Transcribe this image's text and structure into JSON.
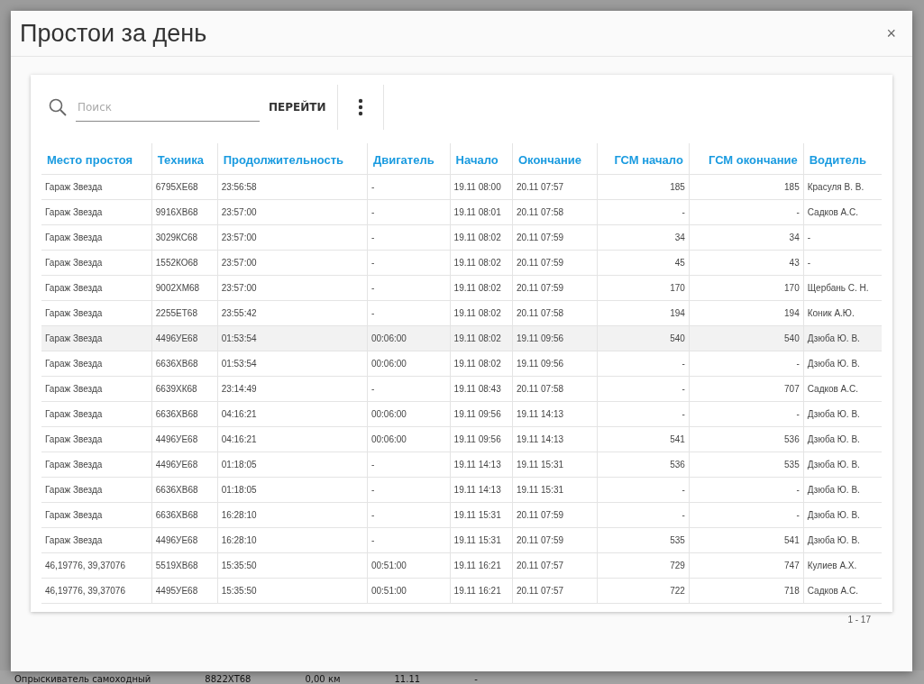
{
  "background_row": {
    "cells": [
      "Опрыскиватель самоходный",
      "8822ХТ68",
      "0,00 км",
      "11.11",
      "-"
    ]
  },
  "dialog": {
    "title": "Простои за день",
    "close": "×"
  },
  "search": {
    "placeholder": "Поиск",
    "button": "ПЕРЕЙТИ"
  },
  "table": {
    "columns": [
      {
        "label": "Место простоя",
        "kind": "text"
      },
      {
        "label": "Техника",
        "kind": "text"
      },
      {
        "label": "Продолжительность",
        "kind": "text"
      },
      {
        "label": "Двигатель",
        "kind": "text"
      },
      {
        "label": "Начало",
        "kind": "text"
      },
      {
        "label": "Окончание",
        "kind": "text"
      },
      {
        "label": "ГСМ начало",
        "kind": "number"
      },
      {
        "label": "ГСМ окончание",
        "kind": "number"
      },
      {
        "label": "Водитель",
        "kind": "text"
      }
    ],
    "rows": [
      {
        "selected": false,
        "cells": [
          "Гараж Звезда",
          "6795ХЕ68",
          "23:56:58",
          "-",
          "19.11 08:00",
          "20.11 07:57",
          "185",
          "185",
          "Красуля В. В."
        ]
      },
      {
        "selected": false,
        "cells": [
          "Гараж Звезда",
          "9916ХВ68",
          "23:57:00",
          "-",
          "19.11 08:01",
          "20.11 07:58",
          "-",
          "-",
          "Садков А.С."
        ]
      },
      {
        "selected": false,
        "cells": [
          "Гараж Звезда",
          "3029КС68",
          "23:57:00",
          "-",
          "19.11 08:02",
          "20.11 07:59",
          "34",
          "34",
          "-"
        ]
      },
      {
        "selected": false,
        "cells": [
          "Гараж Звезда",
          "1552КО68",
          "23:57:00",
          "-",
          "19.11 08:02",
          "20.11 07:59",
          "45",
          "43",
          "-"
        ]
      },
      {
        "selected": false,
        "cells": [
          "Гараж Звезда",
          "9002ХМ68",
          "23:57:00",
          "-",
          "19.11 08:02",
          "20.11 07:59",
          "170",
          "170",
          "Щербань С. Н."
        ]
      },
      {
        "selected": false,
        "cells": [
          "Гараж Звезда",
          "2255ЕТ68",
          "23:55:42",
          "-",
          "19.11 08:02",
          "20.11 07:58",
          "194",
          "194",
          "Коник А.Ю."
        ]
      },
      {
        "selected": true,
        "cells": [
          "Гараж Звезда",
          "4496УЕ68",
          "01:53:54",
          "00:06:00",
          "19.11 08:02",
          "19.11 09:56",
          "540",
          "540",
          "Дзюба Ю. В."
        ]
      },
      {
        "selected": false,
        "cells": [
          "Гараж Звезда",
          "6636ХВ68",
          "01:53:54",
          "00:06:00",
          "19.11 08:02",
          "19.11 09:56",
          "-",
          "-",
          "Дзюба Ю. В."
        ]
      },
      {
        "selected": false,
        "cells": [
          "Гараж Звезда",
          "6639ХК68",
          "23:14:49",
          "-",
          "19.11 08:43",
          "20.11 07:58",
          "-",
          "707",
          "Садков А.С."
        ]
      },
      {
        "selected": false,
        "cells": [
          "Гараж Звезда",
          "6636ХВ68",
          "04:16:21",
          "00:06:00",
          "19.11 09:56",
          "19.11 14:13",
          "-",
          "-",
          "Дзюба Ю. В."
        ]
      },
      {
        "selected": false,
        "cells": [
          "Гараж Звезда",
          "4496УЕ68",
          "04:16:21",
          "00:06:00",
          "19.11 09:56",
          "19.11 14:13",
          "541",
          "536",
          "Дзюба Ю. В."
        ]
      },
      {
        "selected": false,
        "cells": [
          "Гараж Звезда",
          "4496УЕ68",
          "01:18:05",
          "-",
          "19.11 14:13",
          "19.11 15:31",
          "536",
          "535",
          "Дзюба Ю. В."
        ]
      },
      {
        "selected": false,
        "cells": [
          "Гараж Звезда",
          "6636ХВ68",
          "01:18:05",
          "-",
          "19.11 14:13",
          "19.11 15:31",
          "-",
          "-",
          "Дзюба Ю. В."
        ]
      },
      {
        "selected": false,
        "cells": [
          "Гараж Звезда",
          "6636ХВ68",
          "16:28:10",
          "-",
          "19.11 15:31",
          "20.11 07:59",
          "-",
          "-",
          "Дзюба Ю. В."
        ]
      },
      {
        "selected": false,
        "cells": [
          "Гараж Звезда",
          "4496УЕ68",
          "16:28:10",
          "-",
          "19.11 15:31",
          "20.11 07:59",
          "535",
          "541",
          "Дзюба Ю. В."
        ]
      },
      {
        "selected": false,
        "cells": [
          "46,19776, 39,37076",
          "5519ХВ68",
          "15:35:50",
          "00:51:00",
          "19.11 16:21",
          "20.11 07:57",
          "729",
          "747",
          "Кулиев А.Х."
        ]
      },
      {
        "selected": false,
        "cells": [
          "46,19776, 39,37076",
          "4495УЕ68",
          "15:35:50",
          "00:51:00",
          "19.11 16:21",
          "20.11 07:57",
          "722",
          "718",
          "Садков А.С."
        ]
      }
    ]
  },
  "pagination": "1 - 17"
}
